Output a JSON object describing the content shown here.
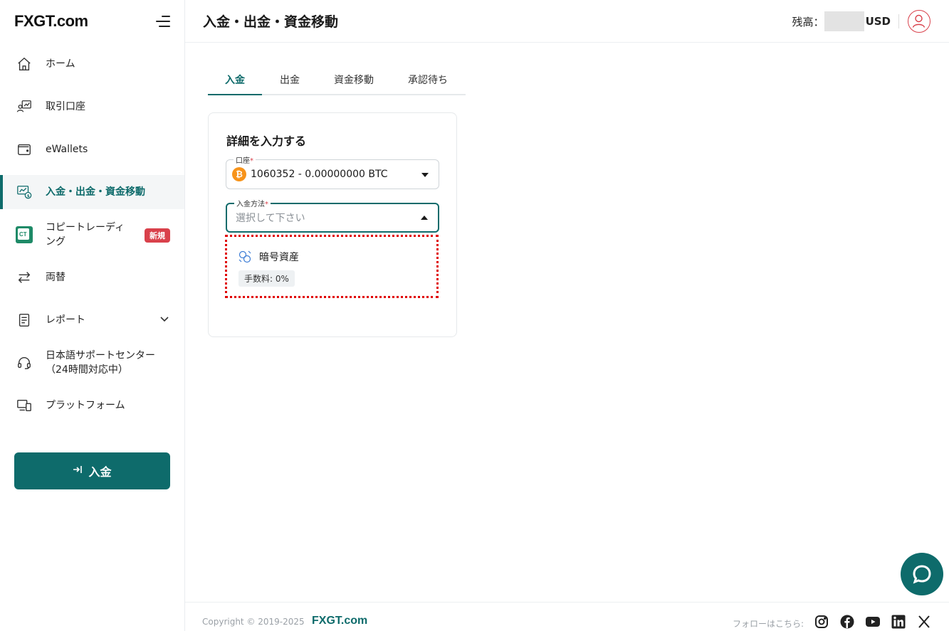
{
  "brand": {
    "logo": "FXGT.com"
  },
  "sidebar": {
    "items": [
      {
        "label": "ホーム",
        "icon": "home-icon"
      },
      {
        "label": "取引口座",
        "icon": "trading-account-icon"
      },
      {
        "label": "eWallets",
        "icon": "wallet-icon"
      },
      {
        "label": "入金・出金・資金移動",
        "icon": "funds-transfer-icon"
      },
      {
        "label": "コピートレーディング",
        "icon": "copy-trading-icon",
        "badge": "新規",
        "icon_text": "CT"
      },
      {
        "label": "両替",
        "icon": "exchange-icon"
      },
      {
        "label": "レポート",
        "icon": "report-icon"
      },
      {
        "label": "日本語サポートセンター（24時間対応中）",
        "label_line1": "日本語サポートセンター",
        "label_line2": "（24時間対応中）",
        "icon": "headset-icon"
      },
      {
        "label": "プラットフォーム",
        "icon": "platform-icon"
      }
    ],
    "deposit_button": "入金"
  },
  "header": {
    "title": "入金・出金・資金移動",
    "balance_label": "残高：",
    "balance_currency": "USD"
  },
  "tabs": [
    {
      "label": "入金",
      "active": true
    },
    {
      "label": "出金",
      "active": false
    },
    {
      "label": "資金移動",
      "active": false
    },
    {
      "label": "承認待ち",
      "active": false
    }
  ],
  "form": {
    "title": "詳細を入力する",
    "account": {
      "label": "口座",
      "required_mark": "*",
      "value": "1060352 - 0.00000000 BTC",
      "currency_icon": "₿"
    },
    "method": {
      "label": "入金方法",
      "required_mark": "*",
      "placeholder": "選択して下さい"
    },
    "options": [
      {
        "name": "暗号資産",
        "fee": "手数料: 0%"
      }
    ]
  },
  "footer": {
    "copyright": "Copyright © 2019-2025",
    "brand": "FXGT.com",
    "follow": "フォローはこちら:",
    "socials": [
      "instagram-icon",
      "facebook-icon",
      "youtube-icon",
      "linkedin-icon",
      "x-icon"
    ]
  },
  "colors": {
    "accent": "#0e6b6b",
    "badge": "#d9414b",
    "btc": "#f7931a",
    "highlight": "#e00000"
  }
}
